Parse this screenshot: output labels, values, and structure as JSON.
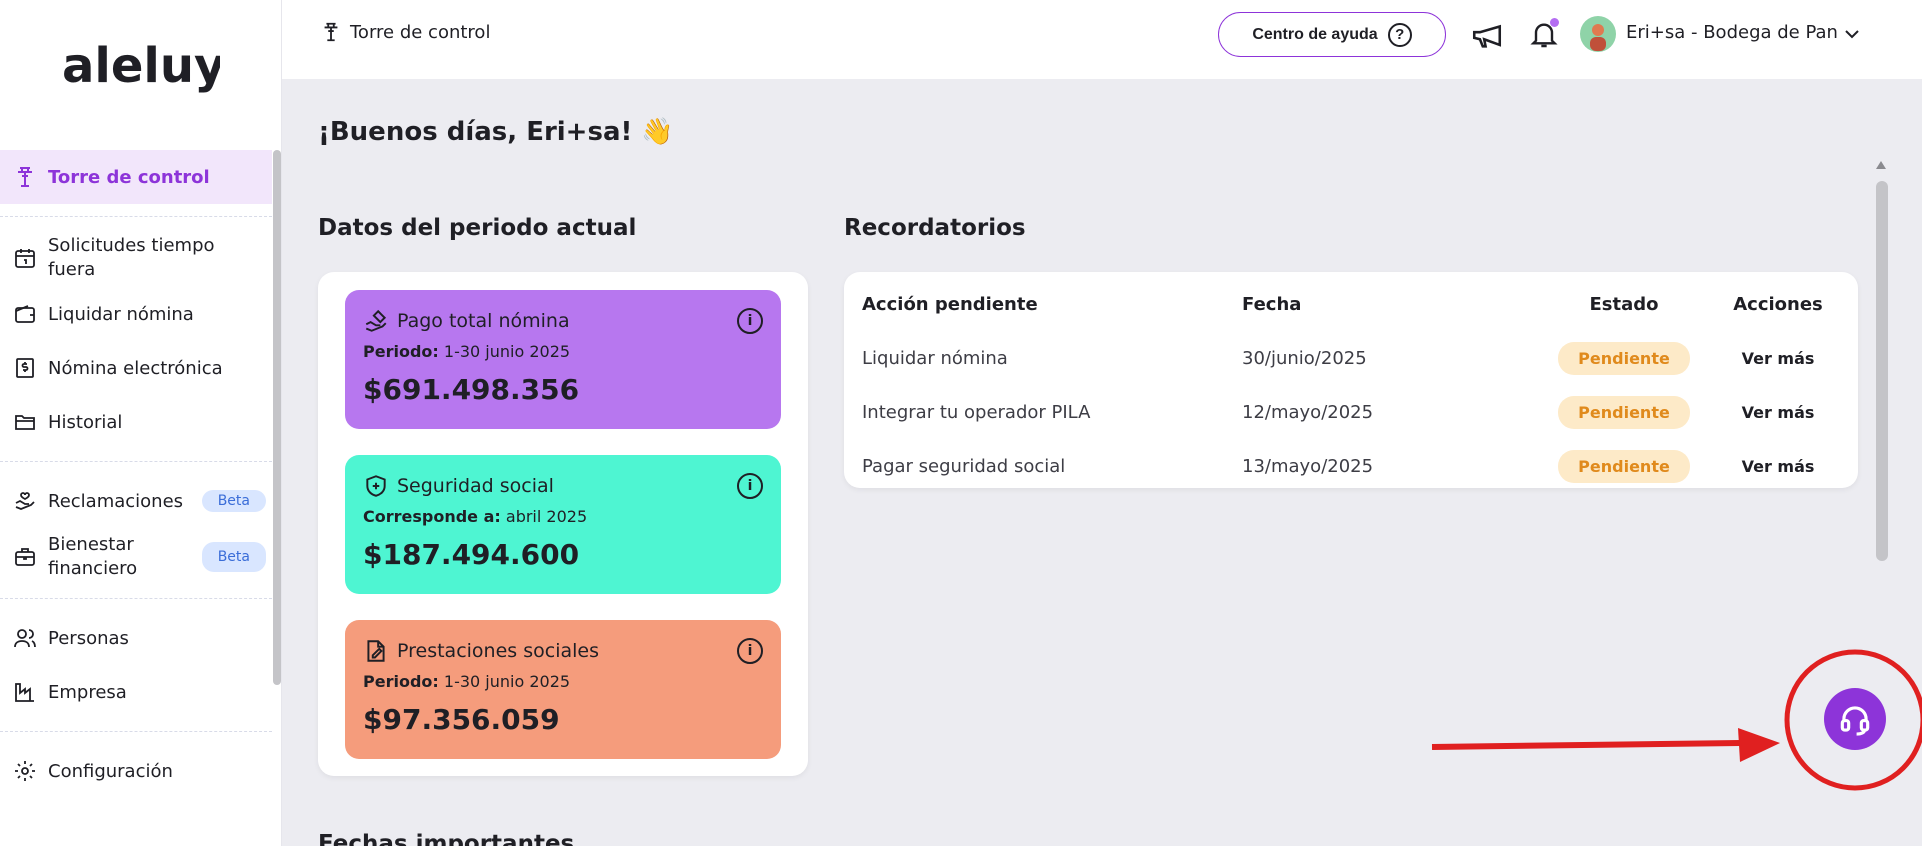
{
  "brand": {
    "logo_text": "aleluya",
    "accent": "#8d34d9"
  },
  "sidebar": {
    "items": [
      {
        "label": "Torre de control",
        "icon": "control-tower-icon",
        "active": true
      },
      {
        "label": "Solicitudes tiempo fuera",
        "icon": "calendar-icon"
      },
      {
        "label": "Liquidar nómina",
        "icon": "wallet-icon"
      },
      {
        "label": "Nómina electrónica",
        "icon": "invoice-dollar-icon"
      },
      {
        "label": "Historial",
        "icon": "folder-icon"
      },
      {
        "label": "Reclamaciones",
        "icon": "hand-heart-icon",
        "badge": "Beta"
      },
      {
        "label": "Bienestar financiero",
        "icon": "briefcase-icon",
        "badge": "Beta"
      },
      {
        "label": "Personas",
        "icon": "people-icon"
      },
      {
        "label": "Empresa",
        "icon": "factory-icon"
      },
      {
        "label": "Configuración",
        "icon": "gear-icon"
      }
    ]
  },
  "topbar": {
    "breadcrumb": "Torre de control",
    "help_label": "Centro de ayuda",
    "help_icon": "?",
    "user_name": "Eri+sa - Bodega de Pan"
  },
  "main": {
    "greeting": "¡Buenos días, Eri+sa! 👋",
    "period_title": "Datos del periodo actual",
    "reminders_title": "Recordatorios",
    "next_title": "Fechas importantes",
    "kpis": [
      {
        "title": "Pago total nómina",
        "period_label": "Periodo:",
        "period_value": "1-30 junio 2025",
        "amount": "$691.498.356",
        "color": "#b777ef",
        "icon": "hand-money-icon"
      },
      {
        "title": "Seguridad social",
        "period_label": "Corresponde a:",
        "period_value": "abril 2025",
        "amount": "$187.494.600",
        "color": "#4ef5d2",
        "icon": "shield-plus-icon"
      },
      {
        "title": "Prestaciones sociales",
        "period_label": "Periodo:",
        "period_value": "1-30 junio 2025",
        "amount": "$97.356.059",
        "color": "#f59c7c",
        "icon": "document-edit-icon"
      }
    ],
    "reminders": {
      "headers": [
        "Acción pendiente",
        "Fecha",
        "Estado",
        "Acciones"
      ],
      "rows": [
        {
          "action": "Liquidar nómina",
          "date": "30/junio/2025",
          "status": "Pendiente",
          "cta": "Ver más"
        },
        {
          "action": "Integrar tu operador PILA",
          "date": "12/mayo/2025",
          "status": "Pendiente",
          "cta": "Ver más"
        },
        {
          "action": "Pagar seguridad social",
          "date": "13/mayo/2025",
          "status": "Pendiente",
          "cta": "Ver más"
        }
      ]
    }
  }
}
